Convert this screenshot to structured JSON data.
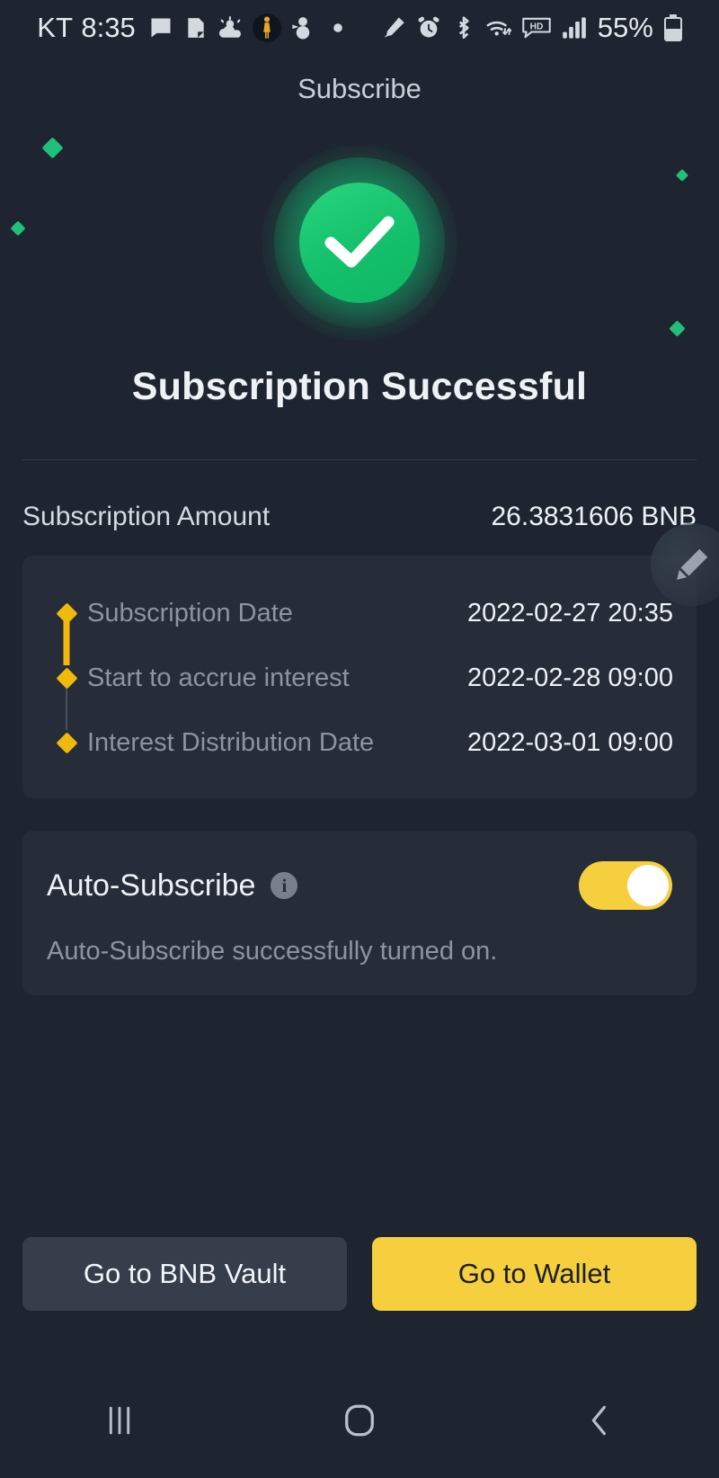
{
  "status_bar": {
    "carrier": "KT",
    "time": "8:35",
    "battery_percent": "55%",
    "icons": [
      "message-icon",
      "note-icon",
      "weather-partly-cloudy-icon",
      "person-avatar-icon",
      "snowman-icon",
      "dot-icon",
      "pen-icon",
      "alarm-clock-icon",
      "bluetooth-icon",
      "wifi-icon",
      "hd-call-icon",
      "signal-bars-icon",
      "battery-icon"
    ]
  },
  "header": {
    "title": "Subscribe"
  },
  "hero": {
    "icon": "success-check-icon",
    "headline": "Subscription Successful",
    "accent_green": "#14c06b"
  },
  "amount": {
    "label": "Subscription Amount",
    "value": "26.3831606 BNB"
  },
  "floating": {
    "pencil_icon": "pencil-edit-icon"
  },
  "timeline": {
    "rows": [
      {
        "label": "Subscription Date",
        "value": "2022-02-27 20:35"
      },
      {
        "label": "Start to accrue interest",
        "value": "2022-02-28 09:00"
      },
      {
        "label": "Interest Distribution Date",
        "value": "2022-03-01 09:00"
      }
    ],
    "marker_color": "#f0b90b"
  },
  "auto_subscribe": {
    "title": "Auto-Subscribe",
    "info_icon": "info-icon",
    "toggle_state": "on",
    "toggle_color": "#f5cf3d",
    "note": "Auto-Subscribe successfully turned on."
  },
  "footer": {
    "secondary_button": "Go to BNB Vault",
    "primary_button": "Go to Wallet"
  },
  "nav_bar": {
    "recents": "recents-icon",
    "home": "home-icon",
    "back": "back-icon"
  }
}
